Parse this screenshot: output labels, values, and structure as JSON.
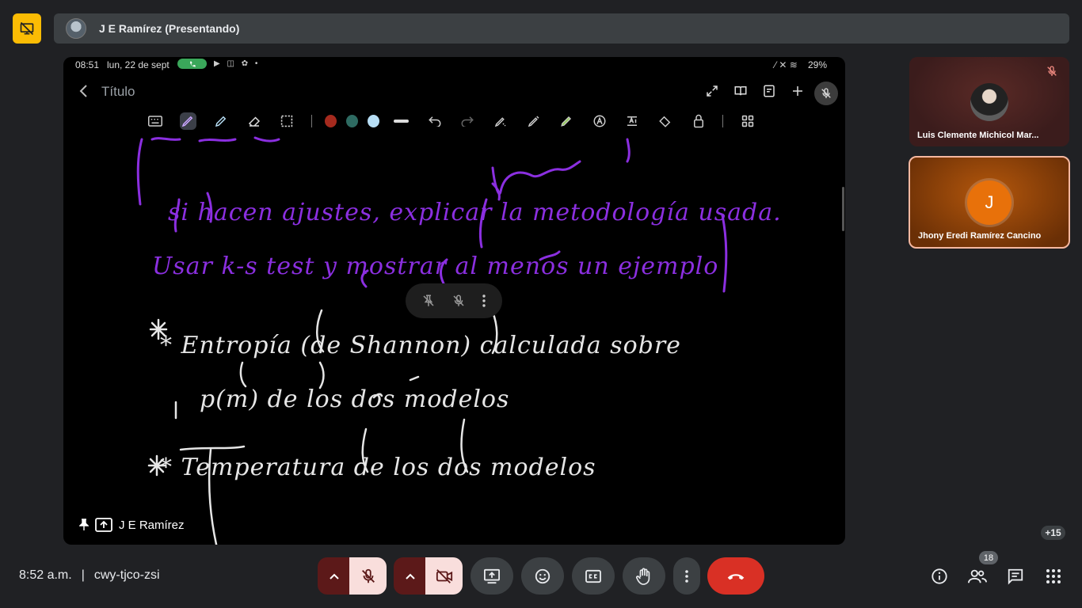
{
  "header": {
    "presenter_title": "J E Ramírez (Presentando)"
  },
  "shared_screen": {
    "status": {
      "time": "08:51",
      "date": "lun, 22 de sept",
      "battery": "29%"
    },
    "app": {
      "title": "Título"
    },
    "colors": {
      "red": "#a52a1e",
      "teal": "#2e6b62",
      "light_blue": "#b7def5",
      "purple_ink": "#8b2fe0",
      "white_ink": "#e6e6e6"
    },
    "notes": {
      "line1": "si hacen ajustes, explicar la metodología usada.",
      "line2": "Usar k-s test y mostrar al menos un ejemplo",
      "line3": "* Entropía (de Shannon) calculada sobre",
      "line4": "p(m) de los dos modelos",
      "line5": "* Temperatura de los dos modelos"
    },
    "owner_label": "J E Ramírez"
  },
  "participants": [
    {
      "name": "Luis Clemente Michicol Mar..."
    },
    {
      "name": "Jhony Eredi Ramírez Cancino",
      "initial": "J"
    }
  ],
  "more_participants": "+15",
  "meeting": {
    "time": "8:52 a.m.",
    "code": "cwy-tjco-zsi"
  },
  "people_count": "18",
  "icons": [
    "presentation-off-icon",
    "back-icon",
    "fullscreen-icon",
    "book-icon",
    "save-icon",
    "plus-icon",
    "more-icon",
    "mic-off-icon",
    "keyboard-icon",
    "pen-icon",
    "highlighter-icon",
    "eraser-icon",
    "selection-icon",
    "undo-icon",
    "redo-icon",
    "shape-icon",
    "text-icon",
    "layers-icon",
    "lock-icon",
    "grid-icon",
    "pin-icon",
    "present-icon",
    "emoji-icon",
    "captions-icon",
    "hand-icon",
    "phone-end-icon",
    "info-icon",
    "people-icon",
    "chat-icon",
    "apps-icon",
    "chevron-up-icon",
    "camera-off-icon"
  ]
}
